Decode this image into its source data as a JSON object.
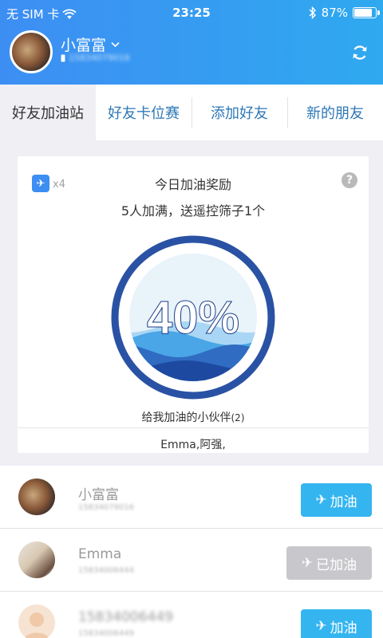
{
  "status_bar": {
    "carrier": "无 SIM 卡",
    "time": "23:25",
    "battery_text": "87%",
    "battery_level": 0.87,
    "icons": [
      "wifi-icon",
      "bluetooth-icon",
      "battery-icon"
    ]
  },
  "profile": {
    "name": "小富富",
    "phone": "15834079016",
    "dropdown_icon": "chevron-down-icon",
    "refresh_icon": "refresh-icon"
  },
  "tabs": [
    {
      "label": "好友加油站",
      "active": true
    },
    {
      "label": "好友卡位赛",
      "active": false
    },
    {
      "label": "添加好友",
      "active": false
    },
    {
      "label": "新的朋友",
      "active": false
    }
  ],
  "reward": {
    "multiplier": "x4",
    "title": "今日加油奖励",
    "subtitle": "5人加满，送遥控筛子1个",
    "progress_text": "40%",
    "progress": 0.4,
    "friends_label": "给我加油的小伙伴",
    "friends_count": "(2)",
    "friends_names": "Emma,阿强,"
  },
  "friends": [
    {
      "name": "小富富",
      "phone": "15834079016",
      "button": "加油",
      "state": "active"
    },
    {
      "name": "Emma",
      "phone": "15834006444",
      "button": "已加油",
      "state": "done"
    },
    {
      "name": "15834006449",
      "phone": "15834006449",
      "button": "加油",
      "state": "active"
    }
  ],
  "colors": {
    "header_start": "#3d8ef3",
    "header_end": "#2fa9ef",
    "accent": "#34b5f0",
    "tab_text": "#2e78b6",
    "ring": "#2a52a4",
    "disabled": "#c8c8cc"
  }
}
